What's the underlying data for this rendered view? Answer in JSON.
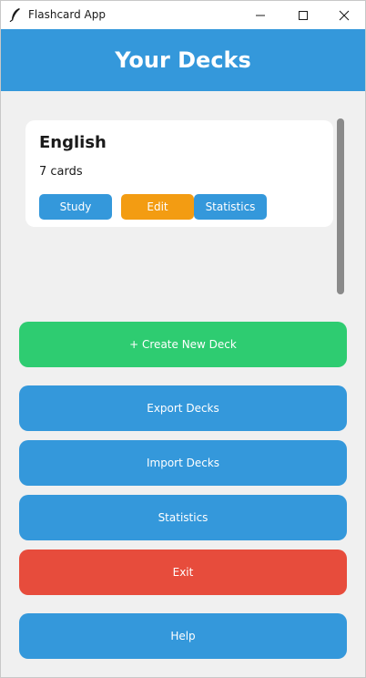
{
  "window": {
    "title": "Flashcard App",
    "icon": "feather-icon"
  },
  "header": {
    "title": "Your Decks"
  },
  "decks": [
    {
      "name": "English",
      "count_text": "7 cards",
      "buttons": {
        "study": "Study",
        "edit": "Edit",
        "statistics": "Statistics"
      }
    }
  ],
  "actions": {
    "create": "+ Create New Deck",
    "export": "Export Decks",
    "import": "Import Decks",
    "statistics": "Statistics",
    "exit": "Exit",
    "help": "Help"
  },
  "colors": {
    "header": "#3498db",
    "primary": "#3498db",
    "create": "#2ecc71",
    "edit": "#f39c12",
    "exit": "#e74c3c",
    "background": "#f0f0f0"
  }
}
